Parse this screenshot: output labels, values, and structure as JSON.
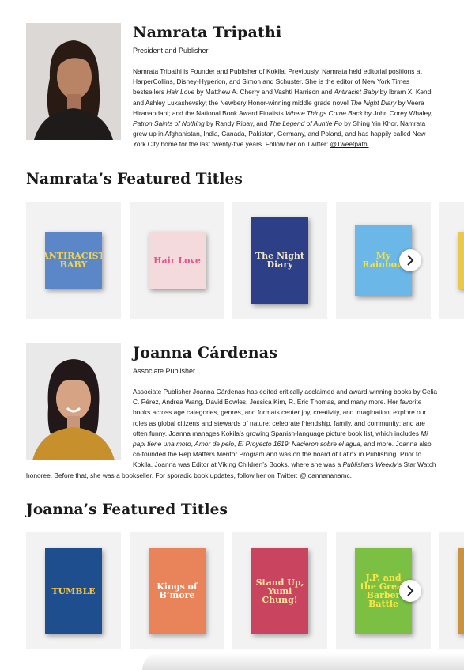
{
  "namrata": {
    "name": "Namrata Tripathi",
    "role": "President and Publisher",
    "bio": [
      {
        "t": "Namrata Tripathi is Founder and Publisher of Kokila. Previously, Namrata held editorial positions at HarperCollins, Disney-Hyperion, and Simon and Schuster. She is the editor of New York Times bestsellers "
      },
      {
        "t": "Hair Love",
        "i": true
      },
      {
        "t": " by Matthew A. Cherry and Vashti Harrison and "
      },
      {
        "t": "Antiracist Baby",
        "i": true
      },
      {
        "t": " by Ibram X. Kendi and Ashley Lukashevsky; the Newbery Honor-winning middle grade novel "
      },
      {
        "t": "The Night Diary",
        "i": true
      },
      {
        "t": " by Veera Hiranandani; and the National Book Award Finalists "
      },
      {
        "t": "Where Things Come Back",
        "i": true
      },
      {
        "t": " by John Corey Whaley, "
      },
      {
        "t": "Patron Saints of Nothing",
        "i": true
      },
      {
        "t": " by Randy Ribay, and "
      },
      {
        "t": "The Legend of Auntie Po",
        "i": true
      },
      {
        "t": " by Shing Yin Khor. Namrata grew up in Afghanistan, India, Canada, Pakistan, Germany, and Poland, and has happily called New York City home for the last twenty-five years. Follow her on Twitter: "
      },
      {
        "t": "@Tweetpathi",
        "link": true
      },
      {
        "t": "."
      }
    ]
  },
  "namrata_titles": {
    "heading": "Namrata’s Featured Titles",
    "books": [
      {
        "name": "antiracist-baby-cover",
        "text": "ANTIRACIST BABY",
        "bg": "#5b87c9",
        "fg": "#f3d34a"
      },
      {
        "name": "hair-love-cover",
        "text": "Hair Love",
        "bg": "#f4d9dd",
        "fg": "#e0568f"
      },
      {
        "name": "the-night-diary-cover",
        "text": "The Night Diary",
        "bg": "#2d3f86",
        "fg": "#f1e6c8"
      },
      {
        "name": "my-rainbow-cover",
        "text": "My Rainbow",
        "bg": "#6ab7e8",
        "fg": "#f6e23c"
      },
      {
        "name": "partial-book-cover",
        "text": "",
        "bg": "#e8c94b",
        "fg": "#2d3f86"
      }
    ]
  },
  "joanna": {
    "name": "Joanna Cárdenas",
    "role": "Associate Publisher",
    "bio": [
      {
        "t": "Associate Publisher Joanna Cárdenas has edited critically acclaimed and award-winning books by Celia C. Pérez, Andrea Wang, David Bowles, Jessica Kim, R. Eric Thomas, and many more. Her favorite books across age categories, genres, and formats center joy, creativity, and imagination; explore our roles as global citizens and stewards of nature; celebrate friendship, family, and community; and are often funny. Joanna manages Kokila’s growing Spanish-language picture book list, which includes "
      },
      {
        "t": "Mi papi tiene una moto",
        "i": true
      },
      {
        "t": ", "
      },
      {
        "t": "Amor de pelo",
        "i": true
      },
      {
        "t": ", "
      },
      {
        "t": "El Proyecto 1619: Nacieron sobre el agua",
        "i": true
      },
      {
        "t": ", and more. Joanna also co-founded the Rep Matters Mentor Program and was on the board of Latinx in Publishing. Prior to Kokila, Joanna was Editor at Viking Children’s Books, where she was a "
      },
      {
        "t": "Publishers Weekly",
        "i": true
      },
      {
        "t": "’s Star Watch honoree. Before that, she was a bookseller. For sporadic book updates, follow her on Twitter: "
      },
      {
        "t": "@joannananamc",
        "link": true
      },
      {
        "t": "."
      }
    ]
  },
  "joanna_titles": {
    "heading": "Joanna’s Featured Titles",
    "books": [
      {
        "name": "tumble-cover",
        "text": "TUMBLE",
        "bg": "#1f4e8f",
        "fg": "#f5c542"
      },
      {
        "name": "kings-of-bmore-cover",
        "text": "Kings of B’more",
        "bg": "#e9835a",
        "fg": "#ffffff"
      },
      {
        "name": "stand-up-yumi-chung-cover",
        "text": "Stand Up, Yumi Chung!",
        "bg": "#c9445e",
        "fg": "#fde7a3"
      },
      {
        "name": "jp-great-barber-battle-cover",
        "text": "J.P. and the Great Barber Battle",
        "bg": "#7cc043",
        "fg": "#fbe64a"
      },
      {
        "name": "partial-book-cover-2",
        "text": "",
        "bg": "#c8923f",
        "fg": "#ffffff"
      }
    ]
  },
  "icons": {
    "next": "chevron-right-icon"
  },
  "colors": {
    "card_bg": "#f2f2f2",
    "text": "#1a1a1a"
  }
}
